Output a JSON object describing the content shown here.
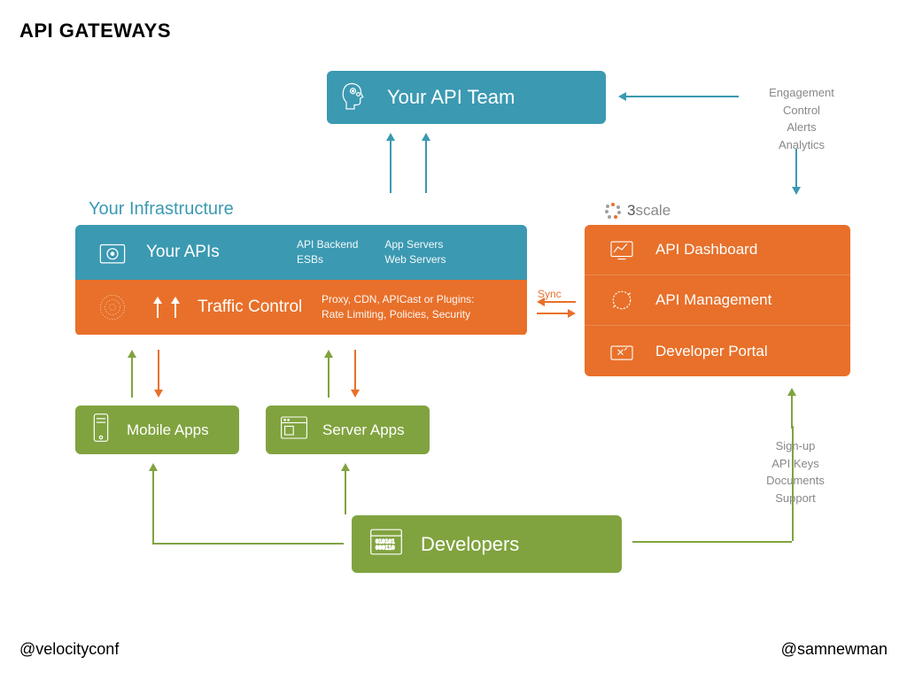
{
  "title": "API GATEWAYS",
  "team": {
    "label": "Your API Team"
  },
  "infrastructure": {
    "header": "Your Infrastructure",
    "apis": {
      "label": "Your APIs",
      "sub1_l1": "API Backend",
      "sub1_l2": "ESBs",
      "sub2_l1": "App Servers",
      "sub2_l2": "Web Servers"
    },
    "traffic": {
      "label": "Traffic Control",
      "sub_l1": "Proxy, CDN, APICast or Plugins:",
      "sub_l2": "Rate Limiting, Policies, Security"
    }
  },
  "threescale": {
    "brand_num": "3",
    "brand_name": "scale",
    "rows": {
      "dashboard": "API Dashboard",
      "management": "API Management",
      "portal": "Developer Portal"
    }
  },
  "apps": {
    "mobile": "Mobile Apps",
    "server": "Server Apps"
  },
  "developers": {
    "label": "Developers"
  },
  "notes": {
    "engage": {
      "l1": "Engagement",
      "l2": "Control",
      "l3": "Alerts",
      "l4": "Analytics"
    },
    "signup": {
      "l1": "Sign-up",
      "l2": "API Keys",
      "l3": "Documents",
      "l4": "Support"
    }
  },
  "sync_label": "Sync",
  "footer": {
    "left": "@velocityconf",
    "right": "@samnewman"
  }
}
